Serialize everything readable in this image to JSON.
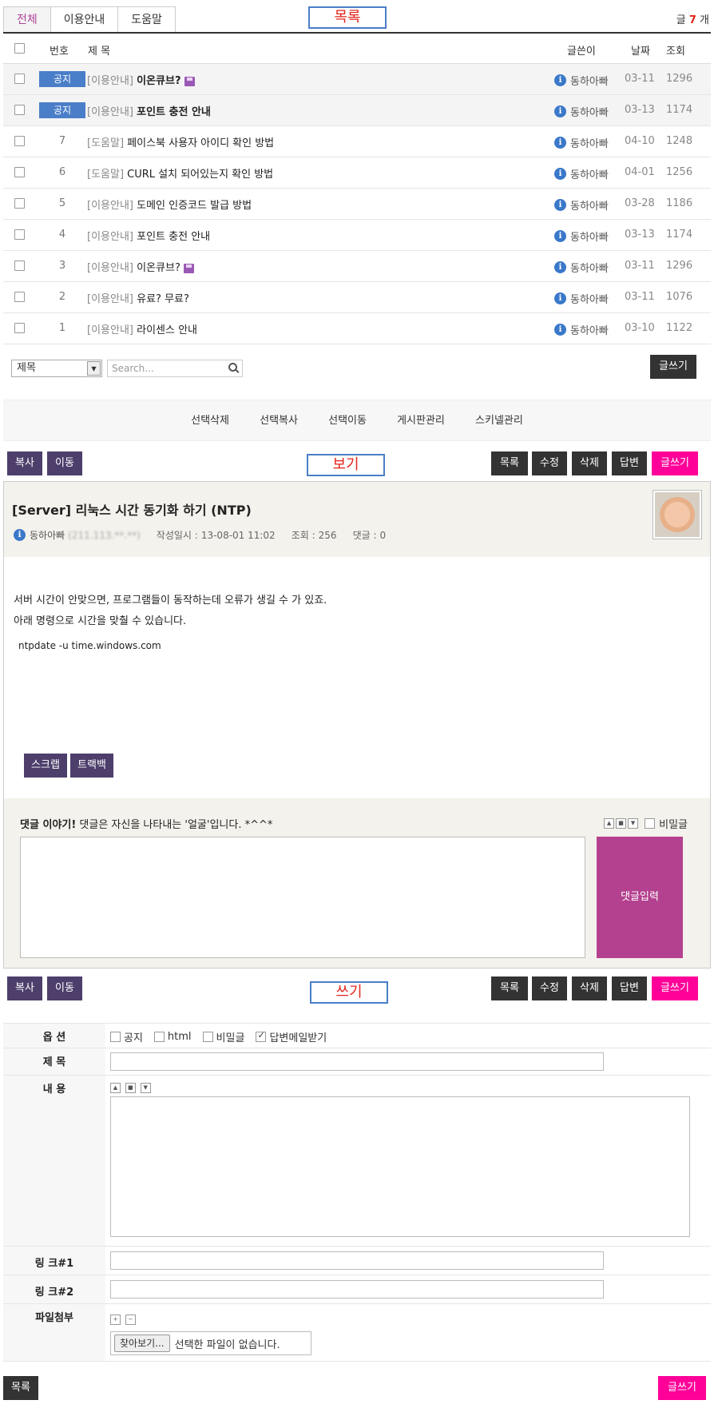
{
  "labels": {
    "list": "목록",
    "view": "보기",
    "write": "쓰기"
  },
  "tabs": [
    {
      "label": "전체"
    },
    {
      "label": "이용안내"
    },
    {
      "label": "도움말"
    }
  ],
  "count": {
    "prefix": "글",
    "num": "7",
    "suffix": "개"
  },
  "list_header": {
    "num": "번호",
    "title": "제 목",
    "author": "글쓴이",
    "date": "날짜",
    "views": "조회"
  },
  "notices": [
    {
      "badge": "공지",
      "cat": "[이용안내]",
      "title": "이온큐브?",
      "author": "동하아빠",
      "date": "03-11",
      "views": "1296"
    },
    {
      "badge": "공지",
      "cat": "[이용안내]",
      "title": "포인트 충전 안내",
      "author": "동하아빠",
      "date": "03-13",
      "views": "1174"
    }
  ],
  "posts": [
    {
      "num": "7",
      "cat": "[도움말]",
      "title": "페이스북 사용자 아이디 확인 방법",
      "author": "동하아빠",
      "date": "04-10",
      "views": "1248"
    },
    {
      "num": "6",
      "cat": "[도움말]",
      "title": "CURL 설치 되어있는지 확인 방법",
      "author": "동하아빠",
      "date": "04-01",
      "views": "1256"
    },
    {
      "num": "5",
      "cat": "[이용안내]",
      "title": "도메인 인증코드 발급 방법",
      "author": "동하아빠",
      "date": "03-28",
      "views": "1186"
    },
    {
      "num": "4",
      "cat": "[이용안내]",
      "title": "포인트 충전 안내",
      "author": "동하아빠",
      "date": "03-13",
      "views": "1174"
    },
    {
      "num": "3",
      "cat": "[이용안내]",
      "title": "이온큐브?",
      "author": "동하아빠",
      "date": "03-11",
      "views": "1296"
    },
    {
      "num": "2",
      "cat": "[이용안내]",
      "title": "유료? 무료?",
      "author": "동하아빠",
      "date": "03-11",
      "views": "1076"
    },
    {
      "num": "1",
      "cat": "[이용안내]",
      "title": "라이센스 안내",
      "author": "동하아빠",
      "date": "03-10",
      "views": "1122"
    }
  ],
  "search": {
    "field": "제목",
    "placeholder": "Search..."
  },
  "write_label": "글쓰기",
  "admin": [
    "선택삭제",
    "선택복사",
    "선택이동",
    "게시판관리",
    "스키넬관리"
  ],
  "view_toolbar": {
    "copy": "복사",
    "move": "이동",
    "list": "목록",
    "edit": "수정",
    "delete": "삭제",
    "reply": "답변",
    "write": "글쓰기"
  },
  "post": {
    "title": "[Server] 리눅스 시간 동기화 하기 (NTP)",
    "author": "동하아빠",
    "ip": "(211.113.**.**)",
    "created_label": "작성일시 :",
    "created": "13-08-01 11:02",
    "views_label": "조회 :",
    "views": "256",
    "comments_label": "댓글 :",
    "comments": "0",
    "body_line1": "서버 시간이 안맞으면, 프로그램들이 동작하는데 오류가 생길 수 가 있죠.",
    "body_line2": "아래 명령으로 시간을 맞춸 수 있습니다.",
    "code": "ntpdate -u time.windows.com",
    "scrap": "스크랩",
    "trackback": "트랙백"
  },
  "comment": {
    "title": "댓글 이야기!",
    "subtitle": "댓글은 자신을 나타내는 '얼굴'입니다. *^^*",
    "secret": "비밀글",
    "submit": "댓글입력"
  },
  "form": {
    "options_label": "옵 션",
    "options": [
      {
        "label": "공지",
        "checked": false
      },
      {
        "label": "html",
        "checked": false
      },
      {
        "label": "비밀글",
        "checked": false
      },
      {
        "label": "답변메일받기",
        "checked": true
      }
    ],
    "subject_label": "제 목",
    "content_label": "내 용",
    "link1_label": "링 크#1",
    "link2_label": "링 크#2",
    "file_label": "파일첨부",
    "file_button": "찾아보기...",
    "file_status": "선택한 파일이 없습니다."
  },
  "bottom": {
    "list": "목록",
    "write": "글쓰기"
  }
}
